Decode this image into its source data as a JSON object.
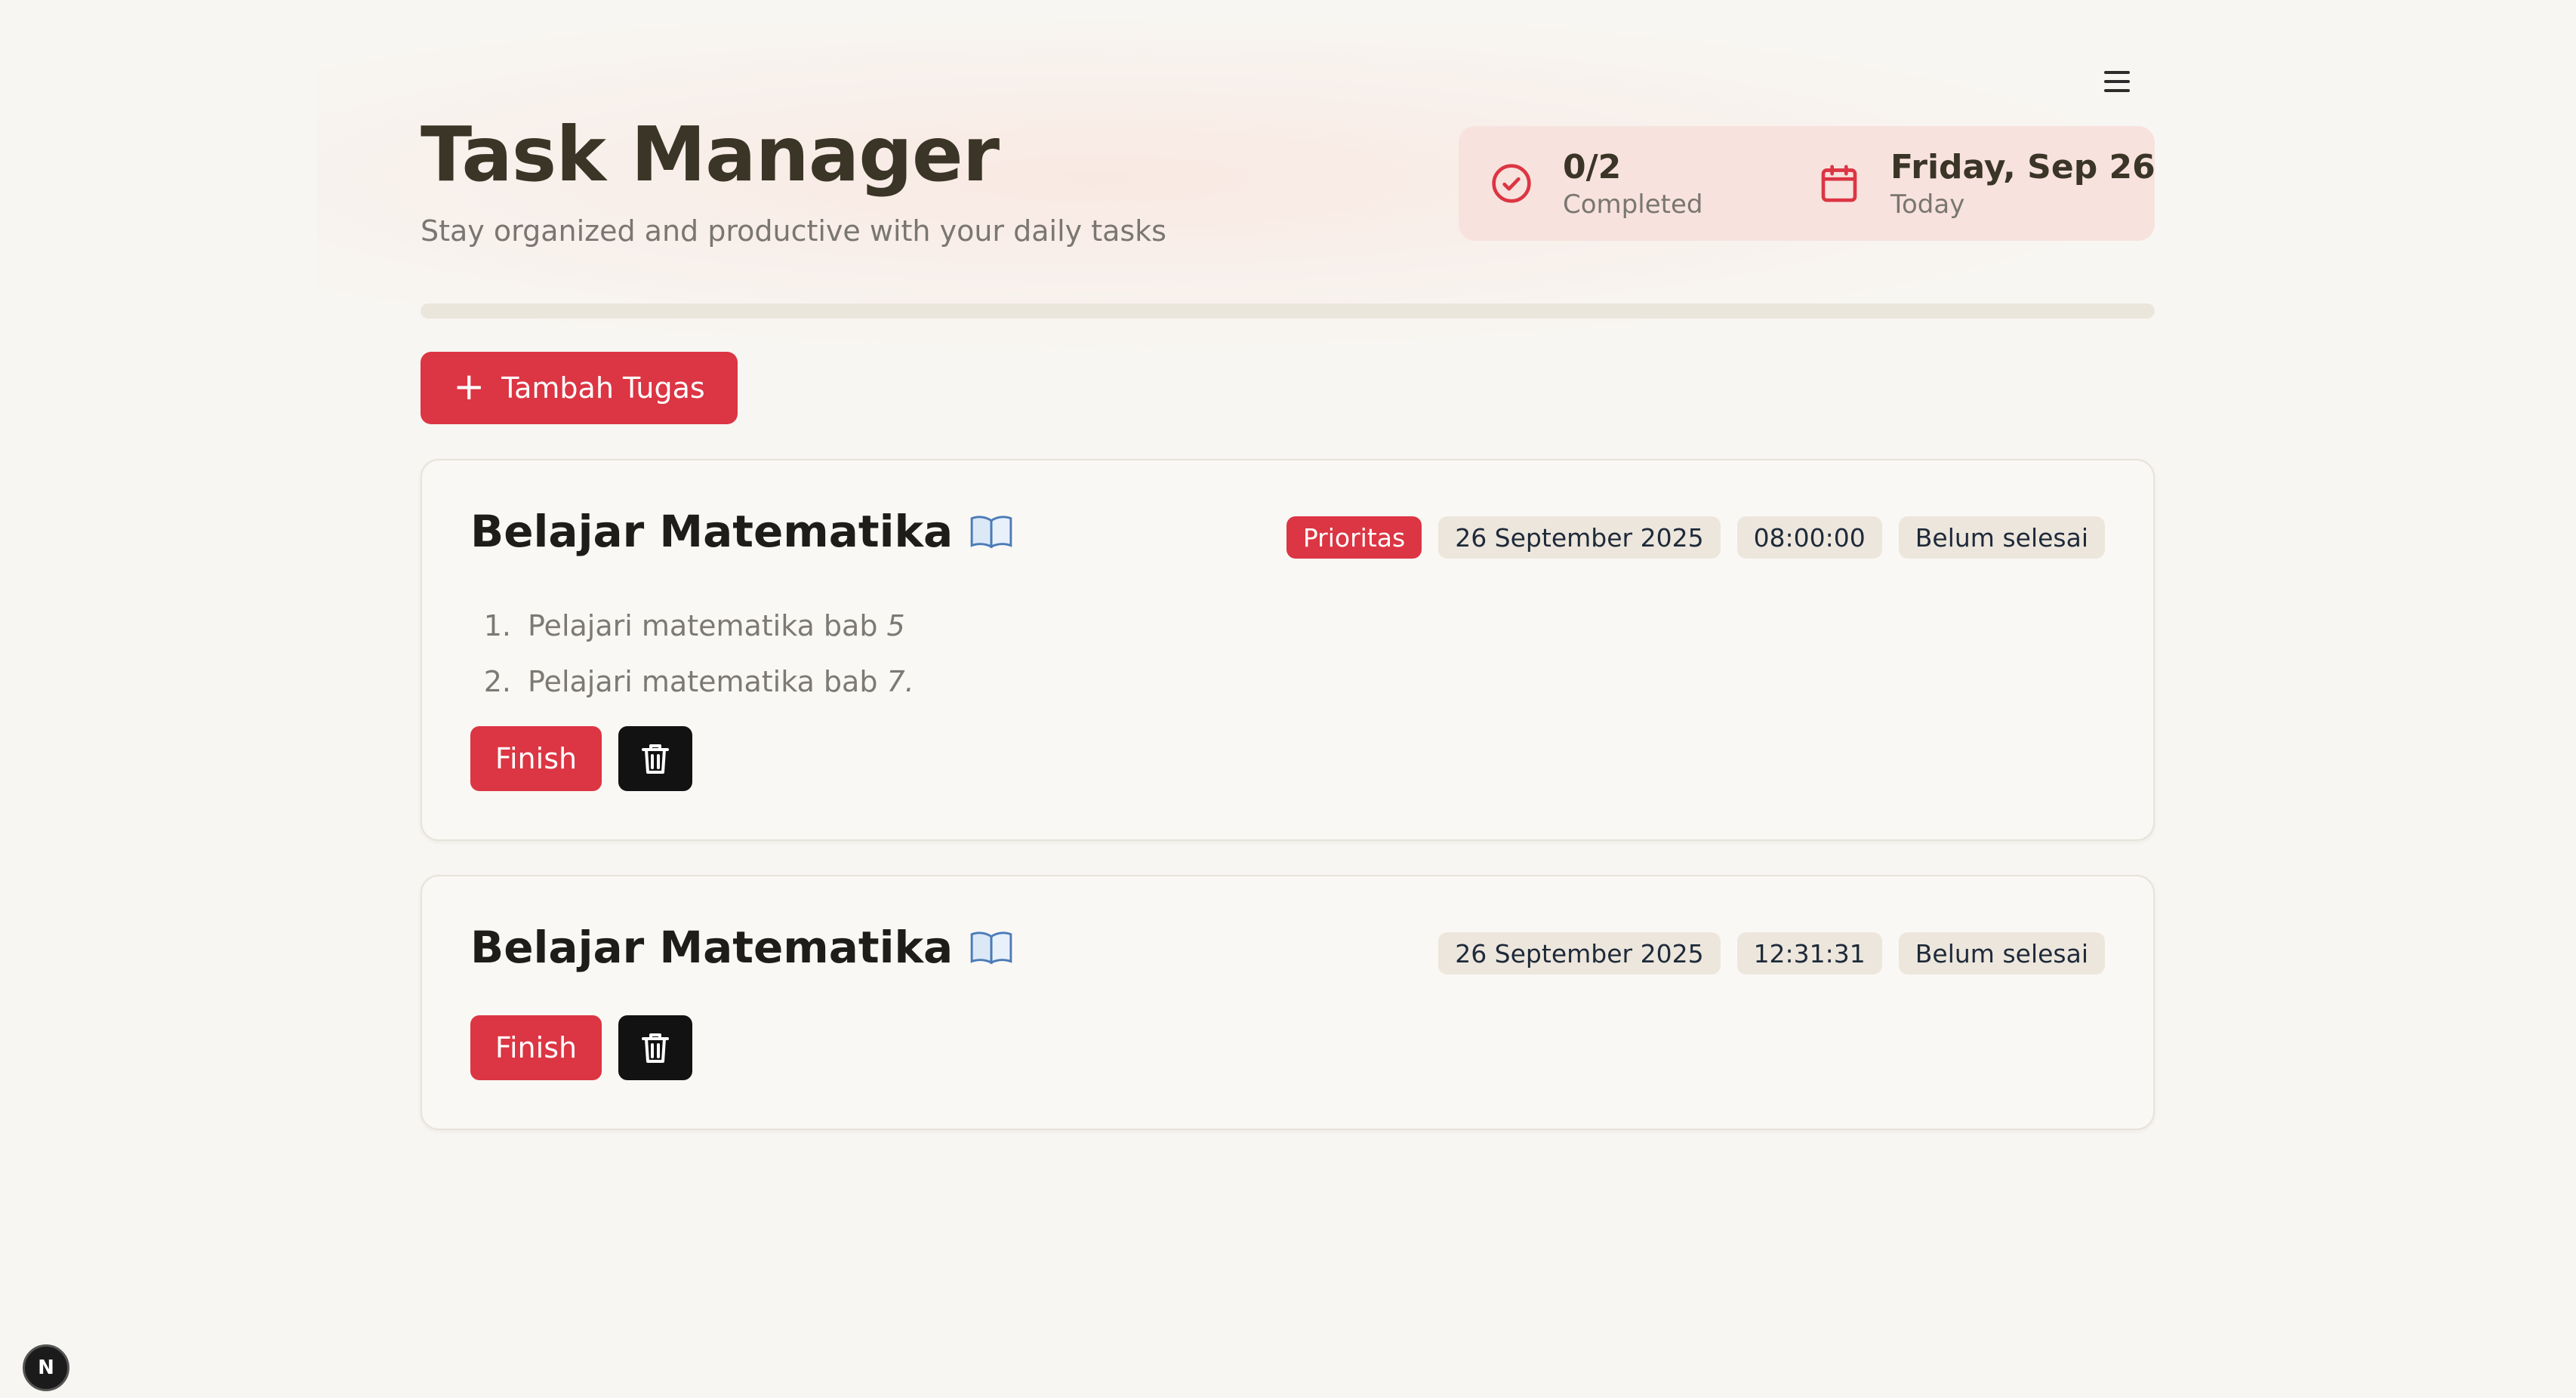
{
  "header": {
    "title": "Task Manager",
    "subtitle": "Stay organized and productive with your daily tasks"
  },
  "stats": {
    "completed_value": "0/2",
    "completed_label": "Completed",
    "date_value": "Friday, Sep 26",
    "date_label": "Today"
  },
  "progress": {
    "completed": 0,
    "total": 2
  },
  "add_button": {
    "label": "Tambah Tugas"
  },
  "tasks": [
    {
      "title": "Belajar Matematika",
      "badges": {
        "priority": "Prioritas",
        "date": "26 September 2025",
        "time": "08:00:00",
        "status": "Belum selesai"
      },
      "steps": [
        {
          "num": "1.",
          "text": "Pelajari matematika bab",
          "emph": "5"
        },
        {
          "num": "2.",
          "text": "Pelajari matematika bab",
          "emph": "7."
        }
      ],
      "finish_label": "Finish"
    },
    {
      "title": "Belajar Matematika",
      "badges": {
        "date": "26 September 2025",
        "time": "12:31:31",
        "status": "Belum selesai"
      },
      "finish_label": "Finish"
    }
  ],
  "dev_badge": {
    "label": "N"
  },
  "colors": {
    "accent": "#dc3543",
    "background": "#f8f6f2",
    "stats_bg": "#f7e2de",
    "badge_bg": "#ede6dc"
  },
  "icons": {
    "menu": "hamburger-menu-icon",
    "completed": "check-circle-icon",
    "date": "calendar-icon",
    "add": "plus-icon",
    "task_emoji": "open-book-icon",
    "delete": "trash-icon"
  }
}
